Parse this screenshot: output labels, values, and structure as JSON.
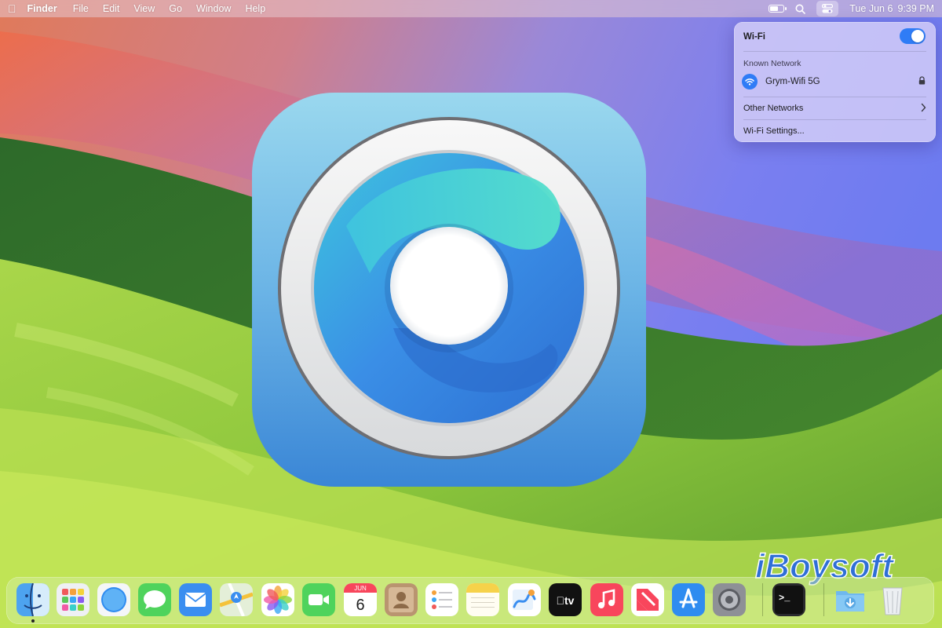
{
  "menubar": {
    "apple_logo": "apple-logo",
    "app_name": "Finder",
    "menus": [
      "File",
      "Edit",
      "View",
      "Go",
      "Window",
      "Help"
    ],
    "battery_level": 0.65,
    "search_icon": "magnifier-icon",
    "control_center_icon": "control-center-icon",
    "date": "Tue Jun 6",
    "time": "9:39 PM"
  },
  "wifi_panel": {
    "title": "Wi-Fi",
    "toggle_on": true,
    "known_network_label": "Known Network",
    "known_network": {
      "name": "Grym-Wifi 5G",
      "secured": true
    },
    "other_networks_label": "Other Networks",
    "settings_label": "Wi-Fi Settings..."
  },
  "app_icon": {
    "icon": "disk-utility-style-app-icon"
  },
  "watermark": {
    "text": "iBoysoft"
  },
  "dock": {
    "items": [
      {
        "name": "finder",
        "icon": "finder-icon",
        "running": true
      },
      {
        "name": "launchpad",
        "icon": "launchpad-icon"
      },
      {
        "name": "safari",
        "icon": "safari-icon"
      },
      {
        "name": "messages",
        "icon": "messages-icon"
      },
      {
        "name": "mail",
        "icon": "mail-icon"
      },
      {
        "name": "maps",
        "icon": "maps-icon"
      },
      {
        "name": "photos",
        "icon": "photos-icon"
      },
      {
        "name": "facetime",
        "icon": "facetime-icon"
      },
      {
        "name": "calendar",
        "icon": "calendar-icon",
        "month": "JUN",
        "day": "6"
      },
      {
        "name": "contacts",
        "icon": "contacts-icon"
      },
      {
        "name": "reminders",
        "icon": "reminders-icon"
      },
      {
        "name": "notes",
        "icon": "notes-icon"
      },
      {
        "name": "freeform",
        "icon": "freeform-icon"
      },
      {
        "name": "tv",
        "icon": "apple-tv-icon",
        "label": "tv"
      },
      {
        "name": "music",
        "icon": "music-icon"
      },
      {
        "name": "news",
        "icon": "news-icon"
      },
      {
        "name": "app-store",
        "icon": "app-store-icon"
      },
      {
        "name": "system-settings",
        "icon": "system-settings-icon"
      },
      {
        "name": "terminal",
        "icon": "terminal-icon",
        "label": ">_"
      },
      {
        "name": "downloads",
        "icon": "downloads-folder-icon"
      },
      {
        "name": "trash",
        "icon": "trash-icon"
      }
    ]
  }
}
